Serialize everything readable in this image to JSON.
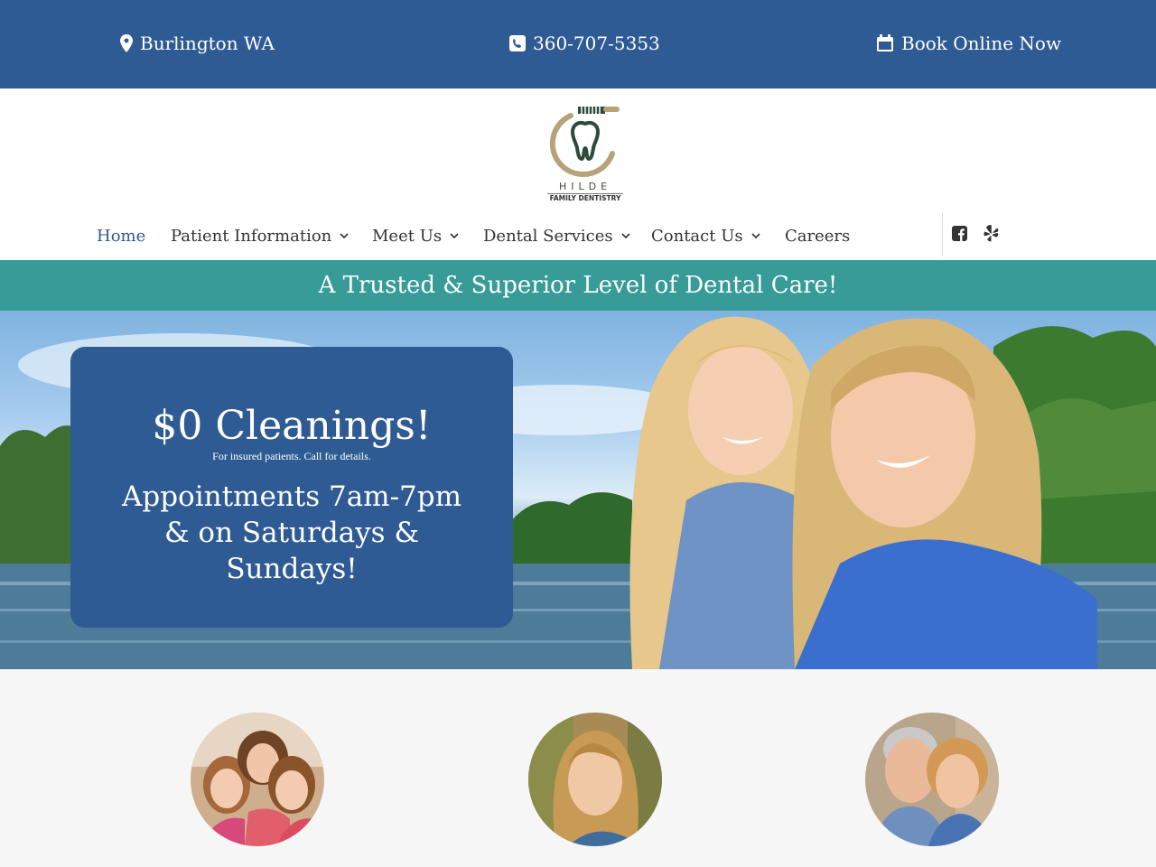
{
  "topbar": {
    "location": "Burlington WA",
    "phone": "360-707-5353",
    "book": "Book Online Now",
    "location_icon": "map-pin-icon",
    "phone_icon": "phone-icon",
    "book_icon": "calendar-icon"
  },
  "logo": {
    "name": "HILDE",
    "subtitle": "FAMILY DENTISTRY"
  },
  "nav": {
    "items": [
      {
        "label": "Home",
        "active": true,
        "has_dropdown": false
      },
      {
        "label": "Patient Information",
        "has_dropdown": true
      },
      {
        "label": "Meet Us",
        "has_dropdown": true
      },
      {
        "label": "Dental Services",
        "has_dropdown": true
      },
      {
        "label": "Contact Us",
        "has_dropdown": true
      },
      {
        "label": "Careers",
        "has_dropdown": false
      }
    ],
    "social": [
      "facebook-icon",
      "yelp-icon"
    ]
  },
  "tagline": "A Trusted & Superior Level of Dental Care!",
  "hero": {
    "title": "$0 Cleanings!",
    "note": "For insured patients. Call for details.",
    "appointments": "Appointments 7am-7pm & on Saturdays & Sundays!"
  },
  "features": [
    {
      "image": "children-photo"
    },
    {
      "image": "young-woman-photo"
    },
    {
      "image": "senior-couple-photo"
    }
  ],
  "colors": {
    "primary": "#2f5b94",
    "teal": "#379b98",
    "logo_gold": "#b8a27a",
    "logo_green": "#2e4a3a"
  }
}
